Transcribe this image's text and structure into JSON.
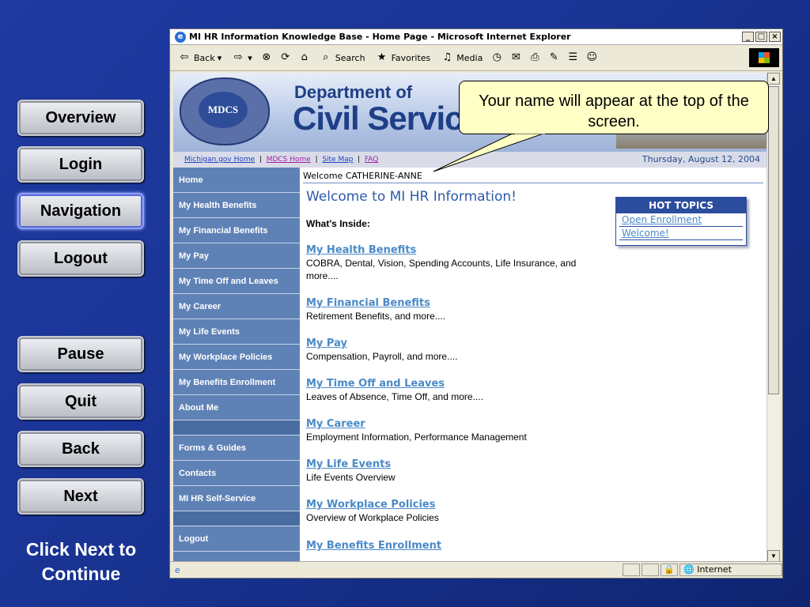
{
  "sidebar": {
    "buttons": [
      "Overview",
      "Login",
      "Navigation",
      "Logout",
      "Pause",
      "Quit",
      "Back",
      "Next"
    ],
    "active": "Navigation",
    "footer": "Click Next to Continue"
  },
  "browser": {
    "title": "MI HR Information Knowledge Base - Home Page - Microsoft Internet Explorer",
    "toolbar": {
      "back": "Back",
      "search": "Search",
      "favorites": "Favorites",
      "media": "Media"
    },
    "status": {
      "zone": "Internet"
    }
  },
  "page": {
    "dept_top": "Department of",
    "dept_main": "Civil Service",
    "seal": "MDCS",
    "links": [
      "Michigan.gov Home",
      "MDCS Home",
      "Site Map",
      "FAQ"
    ],
    "date": "Thursday, August 12, 2004",
    "welcome_user": "Welcome CATHERINE-ANNE",
    "heading": "Welcome to MI HR Information!",
    "whats_inside": "What's Inside:",
    "nav": [
      "Home",
      "My Health Benefits",
      "My Financial Benefits",
      "My Pay",
      "My Time Off and Leaves",
      "My Career",
      "My Life Events",
      "My Workplace Policies",
      "My Benefits Enrollment",
      "About Me",
      "Forms & Guides",
      "Contacts",
      "MI HR Self-Service",
      "Logout"
    ],
    "sections": [
      {
        "title": "My Health Benefits",
        "desc": "COBRA, Dental, Vision, Spending Accounts, Life Insurance, and more...."
      },
      {
        "title": "My Financial Benefits",
        "desc": "Retirement Benefits, and more...."
      },
      {
        "title": "My Pay",
        "desc": "Compensation, Payroll, and more...."
      },
      {
        "title": "My Time Off and Leaves",
        "desc": "Leaves of Absence, Time Off, and more...."
      },
      {
        "title": "My Career",
        "desc": "Employment Information, Performance Management"
      },
      {
        "title": "My Life Events",
        "desc": "Life Events Overview"
      },
      {
        "title": "My Workplace Policies",
        "desc": "Overview of Workplace Policies"
      },
      {
        "title": "My Benefits Enrollment",
        "desc": ""
      }
    ],
    "hot_topics": {
      "header": "HOT TOPICS",
      "items": [
        "Open Enrollment",
        "Welcome!"
      ]
    }
  },
  "callout": "Your name will appear at the top of the screen."
}
